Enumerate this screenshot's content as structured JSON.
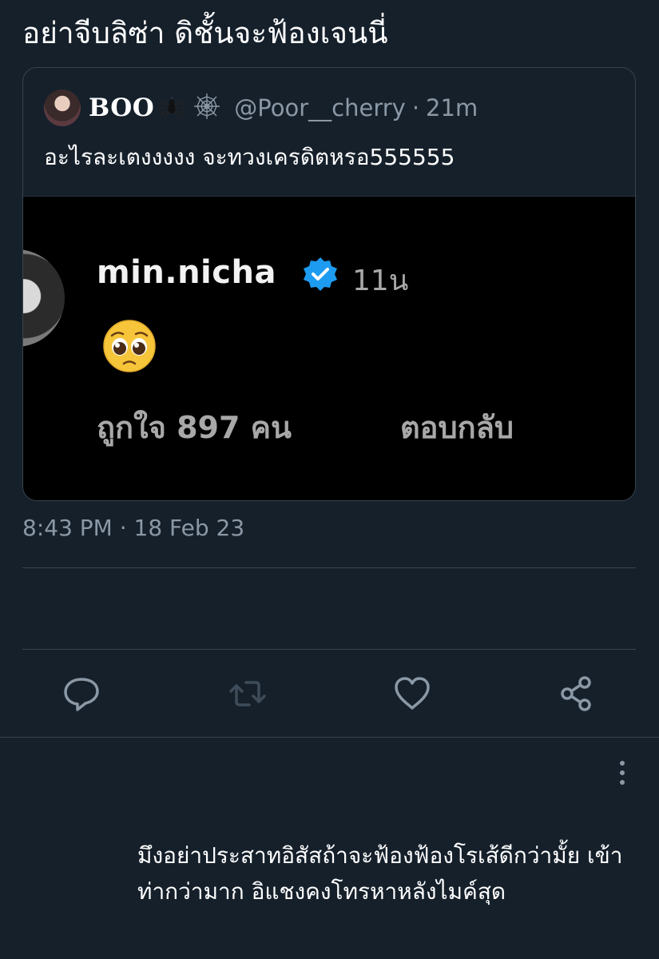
{
  "tweet": {
    "text": "อย่าจีบลิซ่า ดิชั้นจะฟ้องเจนนี่",
    "timestamp": "8:43 PM · 18 Feb 23"
  },
  "quoted": {
    "name": "BOO",
    "handle": "@Poor__cherry",
    "separator": "·",
    "time": "21m",
    "text": "อะไรละเตงงงงง จะทวงเครดิตหรอ555555",
    "name_emojis": [
      "spider-emoji",
      "spider-web-emoji"
    ]
  },
  "media": {
    "username": "min.nicha",
    "time": "11น",
    "reaction_emoji": "pleading-face",
    "likes": "ถูกใจ 897 คน",
    "reply_label": "ตอบกลับ"
  },
  "actions": {
    "icons": [
      "reply-icon",
      "retweet-icon",
      "like-icon",
      "share-icon"
    ],
    "retweet_enabled": false
  },
  "reply": {
    "text": "มึงอย่าประสาทอิสัสถ้าจะฟ้องฟ้องโรเส้ดีกว่ามั้ย เข้าท่ากว่ามาก อิแชงคงโทรหาหลังไมค์สุด"
  },
  "colors": {
    "background": "#15202b",
    "secondary_text": "#8b98a5",
    "border": "#38444d",
    "verified_blue": "#1d9bf0",
    "disabled_icon": "#3e4c59"
  }
}
